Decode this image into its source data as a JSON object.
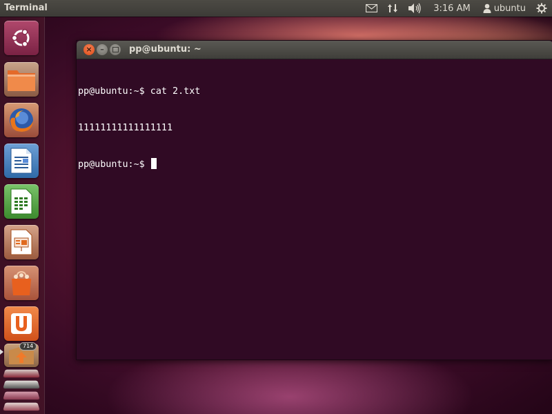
{
  "top_panel": {
    "app_title": "Terminal",
    "clock": "3:16 AM",
    "user_name": "ubuntu",
    "icons": [
      "mail-icon",
      "network-icon",
      "volume-icon",
      "user-icon",
      "power-gear-icon"
    ]
  },
  "launcher": {
    "items": [
      {
        "name": "dash-home",
        "icon": "ubuntu-logo-icon"
      },
      {
        "name": "files",
        "icon": "folder-icon"
      },
      {
        "name": "firefox",
        "icon": "firefox-icon"
      },
      {
        "name": "libreoffice-writer",
        "icon": "writer-icon"
      },
      {
        "name": "libreoffice-calc",
        "icon": "calc-icon"
      },
      {
        "name": "libreoffice-impress",
        "icon": "impress-icon"
      },
      {
        "name": "software-center",
        "icon": "shopping-bag-icon"
      },
      {
        "name": "ubuntu-one",
        "icon": "ubuntu-one-icon"
      },
      {
        "name": "update-manager",
        "icon": "update-icon",
        "badge": "714"
      }
    ]
  },
  "terminal": {
    "title": "pp@ubuntu: ~",
    "lines": [
      "pp@ubuntu:~$ cat 2.txt",
      "11111111111111111",
      "pp@ubuntu:~$ "
    ]
  },
  "colors": {
    "terminal_bg": "#300a24",
    "panel_bg": "#3c3b37",
    "close_button": "#df4a16"
  }
}
